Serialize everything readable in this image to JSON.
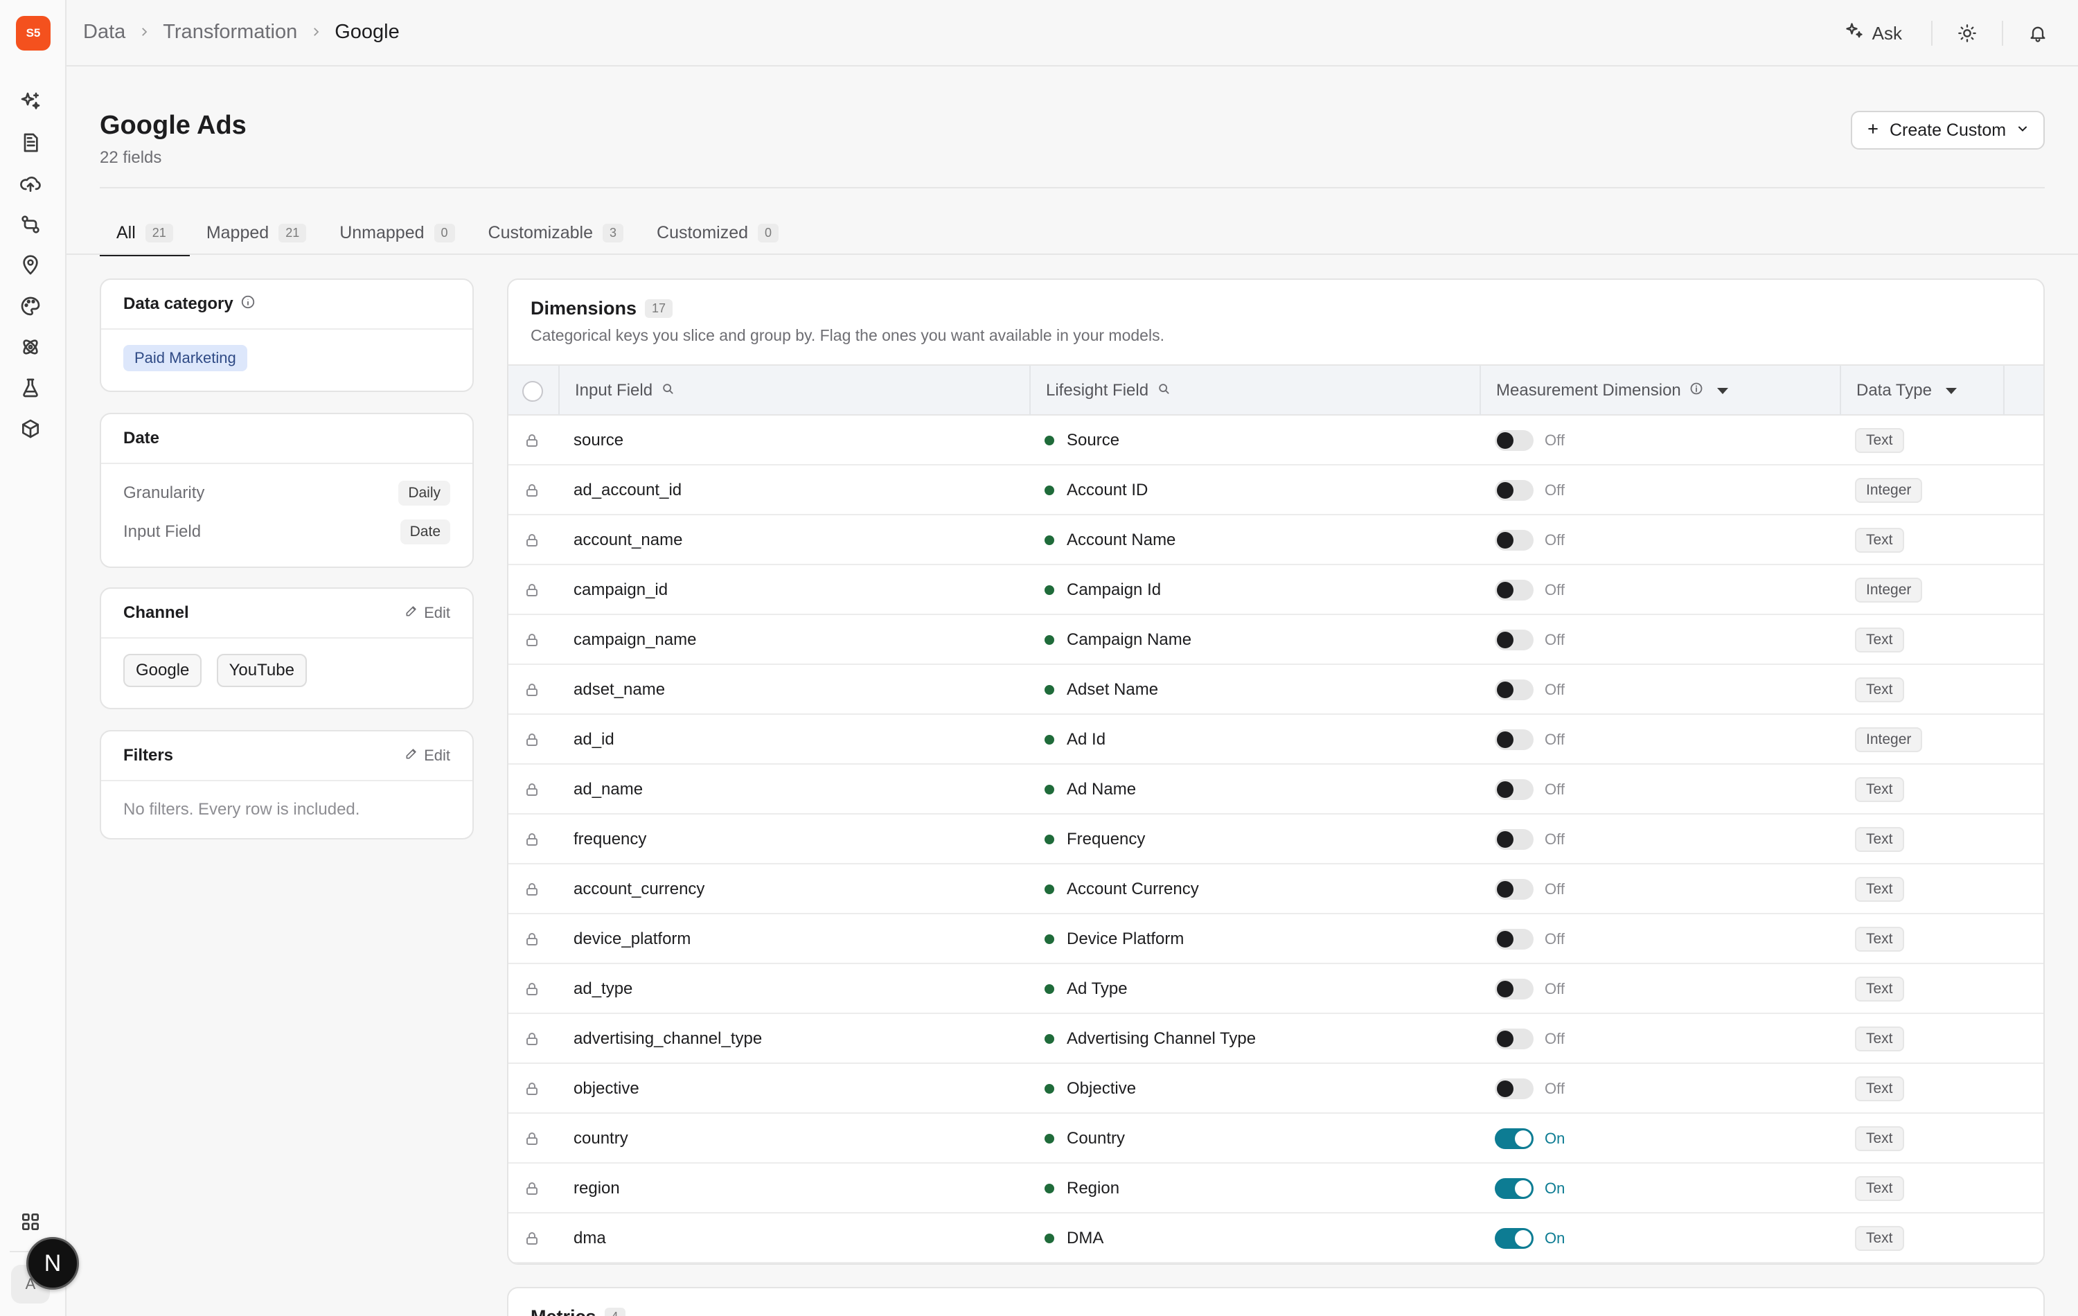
{
  "app": {
    "logo": "S5"
  },
  "breadcrumb": [
    "Data",
    "Transformation",
    "Google"
  ],
  "topbar": {
    "ask_label": "Ask"
  },
  "page": {
    "title": "Google Ads",
    "subtitle": "22 fields",
    "create_label": "Create Custom"
  },
  "tabs": [
    {
      "label": "All",
      "count": "21"
    },
    {
      "label": "Mapped",
      "count": "21"
    },
    {
      "label": "Unmapped",
      "count": "0"
    },
    {
      "label": "Customizable",
      "count": "3"
    },
    {
      "label": "Customized",
      "count": "0"
    }
  ],
  "side": {
    "category": {
      "title": "Data category",
      "tag": "Paid Marketing"
    },
    "date": {
      "title": "Date",
      "granularity_label": "Granularity",
      "granularity_value": "Daily",
      "input_label": "Input Field",
      "input_value": "Date"
    },
    "channel": {
      "title": "Channel",
      "edit": "Edit",
      "chips": [
        "Google",
        "YouTube"
      ]
    },
    "filters": {
      "title": "Filters",
      "edit": "Edit",
      "empty": "No filters. Every row is included."
    }
  },
  "dimensions": {
    "title": "Dimensions",
    "count": "17",
    "description": "Categorical keys you slice and group by. Flag the ones you want available in your models.",
    "columns": {
      "input": "Input Field",
      "lifesight": "Lifesight Field",
      "measurement": "Measurement Dimension",
      "type": "Data Type"
    },
    "rows": [
      {
        "input": "source",
        "field": "Source",
        "state": "Off",
        "type": "Text"
      },
      {
        "input": "ad_account_id",
        "field": "Account ID",
        "state": "Off",
        "type": "Integer"
      },
      {
        "input": "account_name",
        "field": "Account Name",
        "state": "Off",
        "type": "Text"
      },
      {
        "input": "campaign_id",
        "field": "Campaign Id",
        "state": "Off",
        "type": "Integer"
      },
      {
        "input": "campaign_name",
        "field": "Campaign Name",
        "state": "Off",
        "type": "Text"
      },
      {
        "input": "adset_name",
        "field": "Adset Name",
        "state": "Off",
        "type": "Text"
      },
      {
        "input": "ad_id",
        "field": "Ad Id",
        "state": "Off",
        "type": "Integer"
      },
      {
        "input": "ad_name",
        "field": "Ad Name",
        "state": "Off",
        "type": "Text"
      },
      {
        "input": "frequency",
        "field": "Frequency",
        "state": "Off",
        "type": "Text"
      },
      {
        "input": "account_currency",
        "field": "Account Currency",
        "state": "Off",
        "type": "Text"
      },
      {
        "input": "device_platform",
        "field": "Device Platform",
        "state": "Off",
        "type": "Text"
      },
      {
        "input": "ad_type",
        "field": "Ad Type",
        "state": "Off",
        "type": "Text"
      },
      {
        "input": "advertising_channel_type",
        "field": "Advertising Channel Type",
        "state": "Off",
        "type": "Text"
      },
      {
        "input": "objective",
        "field": "Objective",
        "state": "Off",
        "type": "Text"
      },
      {
        "input": "country",
        "field": "Country",
        "state": "On",
        "type": "Text"
      },
      {
        "input": "region",
        "field": "Region",
        "state": "On",
        "type": "Text"
      },
      {
        "input": "dma",
        "field": "DMA",
        "state": "On",
        "type": "Text"
      }
    ]
  },
  "metrics": {
    "title": "Metrics",
    "count": "4"
  },
  "user": {
    "avatar_letter": "N",
    "secondary_letter": "A"
  },
  "colors": {
    "brand": "#f4511e",
    "toggle_on": "#0d7c93",
    "mapped_dot": "#1f6b3a",
    "category_tag": "#dde7fb"
  }
}
